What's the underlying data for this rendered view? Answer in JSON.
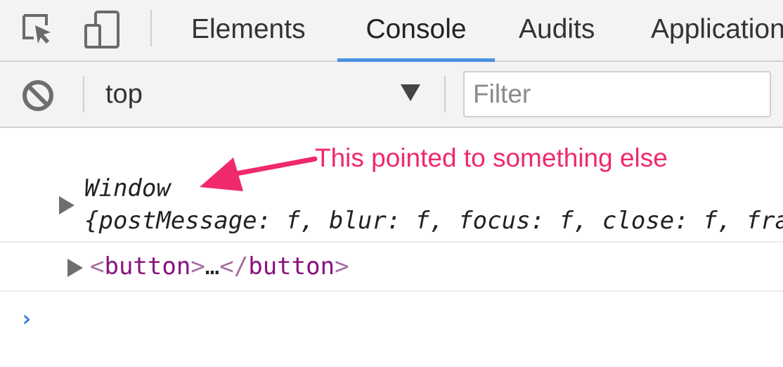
{
  "tabbar": {
    "tabs": [
      {
        "label": "Elements"
      },
      {
        "label": "Console"
      },
      {
        "label": "Audits"
      },
      {
        "label": "Application"
      }
    ],
    "active_tab": "Console"
  },
  "toolbar": {
    "context": "top",
    "filter_placeholder": "Filter"
  },
  "console": {
    "messages": [
      {
        "object_name": "Window",
        "preview": "{postMessage: f, blur: f, focus: f, close: f, frames: Window, …}"
      },
      {
        "open_bracket": "<",
        "tag": "button",
        "close_bracket": ">",
        "ellipsis": "…",
        "end_open": "</",
        "end_tag": "button",
        "end_close": ">"
      }
    ],
    "prompt": "›"
  },
  "annotation": {
    "text": "This pointed to something else",
    "color": "#f0296b"
  },
  "colors": {
    "active_tab_underline": "#4a90e2",
    "tag_name": "#881280",
    "prompt": "#3b7ddd"
  },
  "icons": [
    "inspect-element-icon",
    "device-toolbar-icon",
    "clear-console-icon",
    "dropdown-arrow-icon",
    "expand-arrow-icon"
  ]
}
